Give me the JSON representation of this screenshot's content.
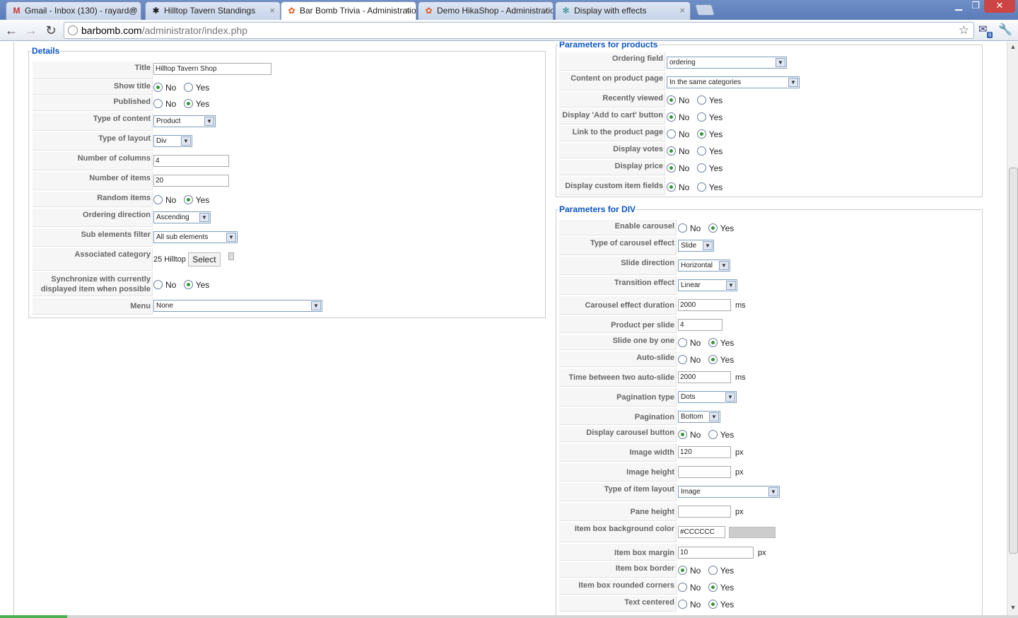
{
  "browser": {
    "tabs": [
      {
        "title": "Gmail - Inbox (130) - rayard@",
        "icon": "gmail-icon",
        "glyph": "M"
      },
      {
        "title": "Hilltop Tavern Standings",
        "icon": "spider-icon",
        "glyph": "✱"
      },
      {
        "title": "Bar Bomb Trivia - Administratio",
        "icon": "joomla-icon",
        "glyph": "✿"
      },
      {
        "title": "Demo HikaShop - Administratio",
        "icon": "joomla-icon",
        "glyph": "✿"
      },
      {
        "title": "Display with effects",
        "icon": "jsfiddle-icon",
        "glyph": "✻"
      }
    ],
    "close_glyph": "×",
    "url_host": "barbomb.com",
    "url_path": "/administrator/index.php",
    "extension_badge": "6"
  },
  "details": {
    "legend": "Details",
    "title_label": "Title",
    "title_value": "Hilltop Tavern Shop",
    "show_title_label": "Show title",
    "published_label": "Published",
    "type_of_content_label": "Type of content",
    "type_of_content_value": "Product",
    "type_of_layout_label": "Type of layout",
    "type_of_layout_value": "Div",
    "number_of_columns_label": "Number of columns",
    "number_of_columns_value": "4",
    "number_of_items_label": "Number of items",
    "number_of_items_value": "20",
    "random_items_label": "Random items",
    "ordering_direction_label": "Ordering direction",
    "ordering_direction_value": "Ascending",
    "sub_elements_filter_label": "Sub elements filter",
    "sub_elements_filter_value": "All sub elements",
    "associated_category_label": "Associated category",
    "associated_category_value": "25 Hilltop",
    "select_button": "Select",
    "sync_label_1": "Synchronize with currently",
    "sync_label_2": "displayed item when possible",
    "menu_label": "Menu",
    "menu_value": "None"
  },
  "products": {
    "legend": "Parameters for products",
    "ordering_field_label": "Ordering field",
    "ordering_field_value": "ordering",
    "content_on_product_page_label": "Content on product page",
    "content_on_product_page_value": "In the same categories",
    "recently_viewed_label": "Recently viewed",
    "add_to_cart_label": "Display 'Add to cart' button",
    "link_product_label": "Link to the product page",
    "display_votes_label": "Display votes",
    "display_price_label": "Display price",
    "custom_fields_label": "Display custom item fields"
  },
  "div": {
    "legend": "Parameters for DIV",
    "enable_carousel_label": "Enable carousel",
    "carousel_effect_label": "Type of carousel effect",
    "carousel_effect_value": "Slide",
    "slide_direction_label": "Slide direction",
    "slide_direction_value": "Horizontal",
    "transition_effect_label": "Transition effect",
    "transition_effect_value": "Linear",
    "effect_duration_label": "Carousel effect duration",
    "effect_duration_value": "2000",
    "product_per_slide_label": "Product per slide",
    "product_per_slide_value": "4",
    "slide_one_by_one_label": "Slide one by one",
    "auto_slide_label": "Auto-slide",
    "time_between_label": "Time between two auto-slide",
    "time_between_value": "2000",
    "pagination_type_label": "Pagination type",
    "pagination_type_value": "Dots",
    "pagination_label": "Pagination",
    "pagination_value": "Bottom",
    "carousel_button_label": "Display carousel button",
    "image_width_label": "Image width",
    "image_width_value": "120",
    "image_height_label": "Image height",
    "image_height_value": "",
    "item_layout_label": "Type of item layout",
    "item_layout_value": "Image",
    "pane_height_label": "Pane height",
    "pane_height_value": "",
    "bg_color_label": "Item box background color",
    "bg_color_value": "#CCCCCC",
    "box_margin_label": "Item box margin",
    "box_margin_value": "10",
    "box_border_label": "Item box border",
    "rounded_corners_label": "Item box rounded corners",
    "text_centered_label": "Text centered"
  },
  "common": {
    "no": "No",
    "yes": "Yes",
    "ms": "ms",
    "px": "px",
    "arrow": "▼"
  },
  "colors": {
    "legend": "#0b55c4",
    "radio_checked": "#2f9a35",
    "swatch": "#cccccc"
  }
}
